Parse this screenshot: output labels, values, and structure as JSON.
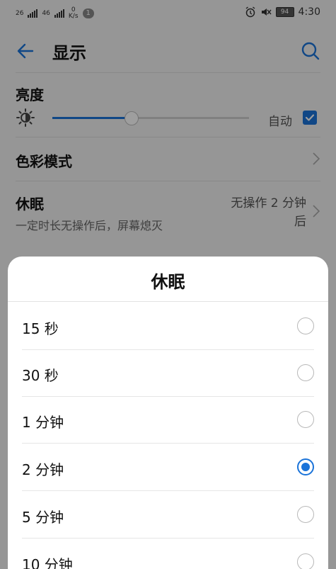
{
  "status_bar": {
    "signal1": "26",
    "signal2": "46",
    "net_speed": "0",
    "net_unit": "K/s",
    "notif_count": "1",
    "battery": "94",
    "time": "4:30"
  },
  "appbar": {
    "title": "显示"
  },
  "brightness": {
    "label": "亮度",
    "level": 0.4,
    "auto_label": "自动",
    "auto_checked": true
  },
  "rows": {
    "color_mode": {
      "title": "色彩模式"
    },
    "sleep": {
      "title": "休眠",
      "subtitle": "一定时长无操作后，屏幕熄灭",
      "value_line1": "无操作 2 分钟",
      "value_line2": "后"
    }
  },
  "dialog": {
    "title": "休眠",
    "options": [
      {
        "label": "15 秒",
        "selected": false
      },
      {
        "label": "30 秒",
        "selected": false
      },
      {
        "label": "1 分钟",
        "selected": false
      },
      {
        "label": "2 分钟",
        "selected": true
      },
      {
        "label": "5 分钟",
        "selected": false
      },
      {
        "label": "10 分钟",
        "selected": false
      }
    ]
  },
  "colors": {
    "accent": "#1a73d9"
  }
}
